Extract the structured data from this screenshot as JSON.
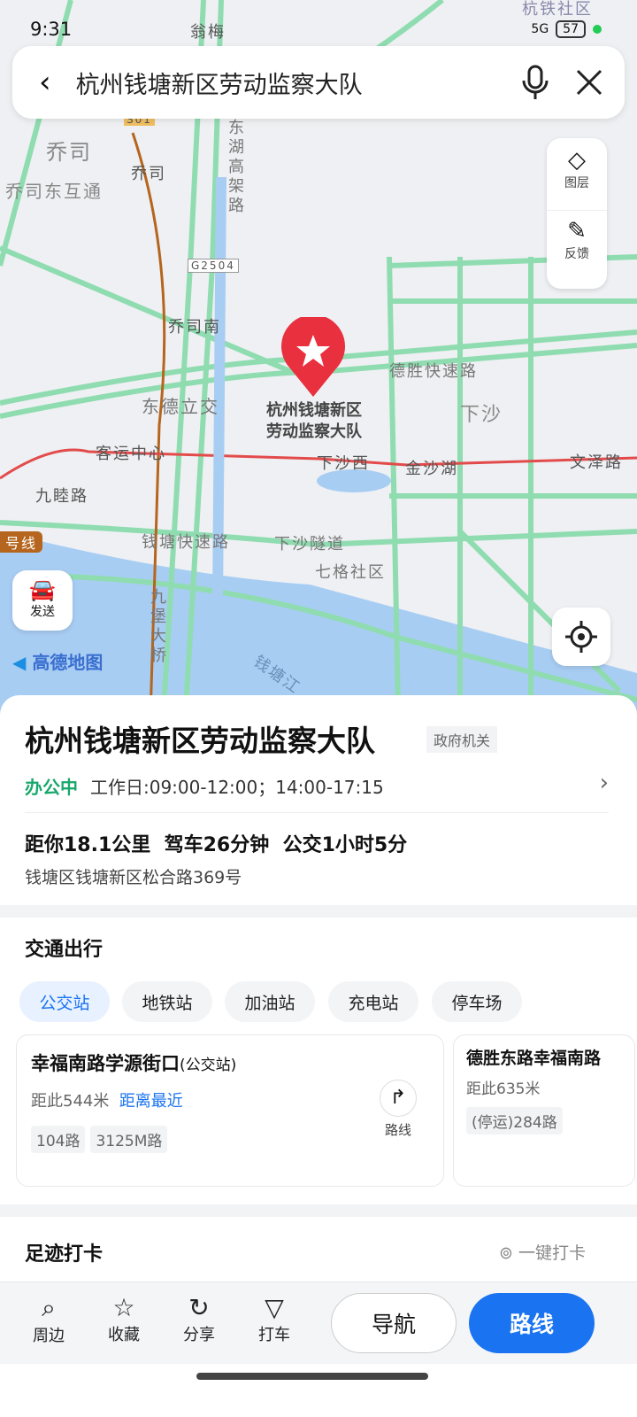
{
  "status": {
    "time": "9:31",
    "battery": "57",
    "network": "5G"
  },
  "search": {
    "query": "杭州钱塘新区劳动监察大队"
  },
  "map": {
    "labels": [
      "翁梅",
      "乔司",
      "乔司东互通",
      "乔司南",
      "东德立交",
      "客运中心",
      "九睦路",
      "下沙西",
      "金沙湖",
      "文泽路",
      "德胜快速路",
      "下沙",
      "钱塘快速路",
      "下沙隧道",
      "七格社区",
      "九堡大桥",
      "杭铁社区",
      "S01",
      "G2504",
      "东湖高架路",
      "号线",
      "钱塘江"
    ],
    "marker_label": [
      "杭州钱塘新区",
      "劳动监察大队"
    ],
    "layers_label": "图层",
    "feedback_label": "反馈",
    "send_label": "发送",
    "logo": "高德地图"
  },
  "place": {
    "name": "杭州钱塘新区劳动监察大队",
    "category": "政府机关",
    "open_status": "办公中",
    "hours": "工作日:09:00-12:00；14:00-17:15",
    "distance": "距你18.1公里",
    "drive": "驾车26分钟",
    "transit": "公交1小时5分",
    "address": "钱塘区钱塘新区松合路369号"
  },
  "transport": {
    "title": "交通出行",
    "tabs": [
      "公交站",
      "地铁站",
      "加油站",
      "充电站",
      "停车场"
    ],
    "active_tab": 0,
    "stops": [
      {
        "name": "幸福南路学源街口",
        "type": "(公交站)",
        "distance": "距此544米",
        "badge": "距离最近",
        "lines": [
          "104路",
          "3125M路"
        ],
        "route_label": "路线"
      },
      {
        "name": "德胜东路幸福南路",
        "distance": "距此635米",
        "lines": [
          "(停运)284路"
        ]
      }
    ]
  },
  "checkin": {
    "title": "足迹打卡",
    "action": "一键打卡"
  },
  "bottom": {
    "items": [
      "周边",
      "收藏",
      "分享",
      "打车"
    ],
    "navigate": "导航",
    "route": "路线"
  },
  "colors": {
    "accent": "#1a73f0",
    "open": "#17a86b",
    "marker": "#e8303e",
    "road": "#8fdcb0"
  }
}
